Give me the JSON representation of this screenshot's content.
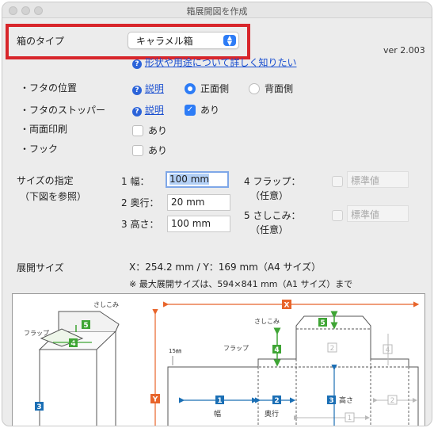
{
  "window": {
    "title": "箱展開図を作成"
  },
  "box_type": {
    "label": "箱のタイプ",
    "selected": "キャラメル箱",
    "help_link": "形状や用途について詳しく知りたい"
  },
  "version": "ver 2.003",
  "lid_position": {
    "label": "・フタの位置",
    "help": "説明",
    "options": [
      "正面側",
      "背面側"
    ],
    "selected": "正面側"
  },
  "lid_stopper": {
    "label": "・フタのストッパー",
    "help": "説明",
    "checkbox_label": "あり",
    "checked": true
  },
  "double_print": {
    "label": "・両面印刷",
    "checkbox_label": "あり",
    "checked": false
  },
  "hook": {
    "label": "・フック",
    "checkbox_label": "あり",
    "checked": false
  },
  "size": {
    "label": "サイズの指定",
    "sublabel": "（下図を参照）",
    "width_label": "1 幅：",
    "width_value": "100 mm",
    "depth_label": "2 奥行：",
    "depth_value": "20 mm",
    "height_label": "3 高さ：",
    "height_value": "100 mm",
    "flap_label": "4 フラップ：",
    "flap_sub": "（任意）",
    "flap_placeholder": "標準値",
    "tuck_label": "5 さしこみ：",
    "tuck_sub": "（任意）",
    "tuck_placeholder": "標準値"
  },
  "unfold": {
    "label": "展開サイズ",
    "value": "X：254.2 mm / Y：169 mm（A4 サイズ）",
    "note": "※ 最大展開サイズは、594×841 mm（A1 サイズ）まで"
  },
  "diagram": {
    "tuck": "さしこみ",
    "flap": "フラップ",
    "mm15": "15㎜",
    "width": "幅",
    "depth": "奥行",
    "height": "高さ",
    "x": "X",
    "y": "Y",
    "n1": "1",
    "n2": "2",
    "n3": "3",
    "n4": "4",
    "n5": "5",
    "colors": {
      "blue": "#1b6fb5",
      "green": "#3fa535",
      "orange": "#e8642a",
      "grey": "#b9b9b9"
    }
  }
}
